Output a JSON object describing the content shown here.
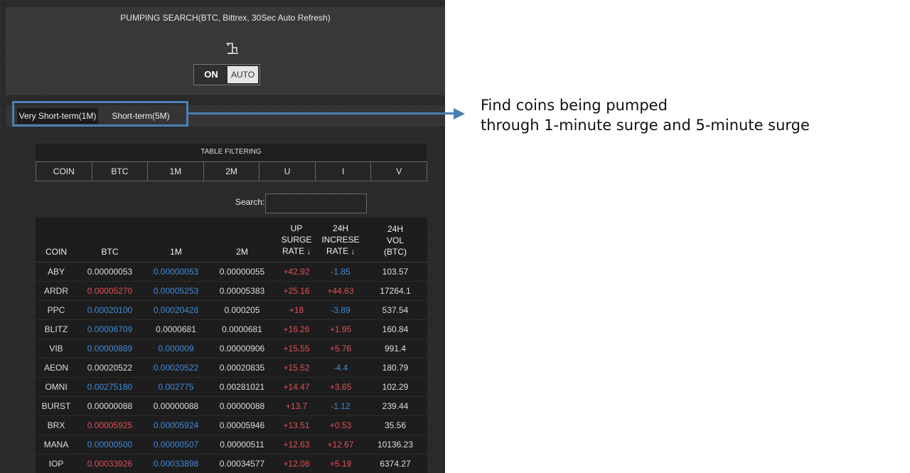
{
  "header": {
    "title": "PUMPING SEARCH(BTC, Bittrex, 30Sec Auto Refresh)",
    "refresh_icon": "refresh-icon",
    "toggle_on": "ON",
    "toggle_auto": "AUTO"
  },
  "tabs": [
    {
      "label": "Very Short-term(1M)"
    },
    {
      "label": "Short-term(5M)"
    }
  ],
  "filter": {
    "title": "TABLE FILTERING",
    "buttons": [
      "COIN",
      "BTC",
      "1M",
      "2M",
      "U",
      "I",
      "V"
    ]
  },
  "search": {
    "label": "Search:",
    "value": "",
    "placeholder": ""
  },
  "table": {
    "headers": {
      "coin": "COIN",
      "btc": "BTC",
      "m1": "1M",
      "m2": "2M",
      "up_l1": "UP",
      "up_l2": "SURGE",
      "up_l3": "RATE",
      "inc_l1": "24H",
      "inc_l2": "INCRESE",
      "inc_l3": "RATE",
      "vol_l1": "24H",
      "vol_l2": "VOL",
      "vol_l3": "(BTC)",
      "sort_arrow": "↓"
    },
    "rows": [
      {
        "coin": "ABY",
        "btc": "0.00000053",
        "m1": "0.00000053",
        "m2": "0.00000055",
        "up": "+42.92",
        "inc": "-1.85",
        "vol": "103.57"
      },
      {
        "coin": "ARDR",
        "btc": "0.00005270",
        "m1": "0.00005253",
        "m2": "0.00005383",
        "up": "+25.16",
        "inc": "+44.63",
        "vol": "17264.1"
      },
      {
        "coin": "PPC",
        "btc": "0.00020100",
        "m1": "0.00020428",
        "m2": "0.000205",
        "up": "+18",
        "inc": "-3.89",
        "vol": "537.54"
      },
      {
        "coin": "BLITZ",
        "btc": "0.00006709",
        "m1": "0.0000681",
        "m2": "0.0000681",
        "up": "+16.26",
        "inc": "+1.95",
        "vol": "160.84"
      },
      {
        "coin": "VIB",
        "btc": "0.00000889",
        "m1": "0.000009",
        "m2": "0.00000906",
        "up": "+15.55",
        "inc": "+5.76",
        "vol": "991.4"
      },
      {
        "coin": "AEON",
        "btc": "0.00020522",
        "m1": "0.00020522",
        "m2": "0.00020835",
        "up": "+15.52",
        "inc": "-4.4",
        "vol": "180.79"
      },
      {
        "coin": "OMNI",
        "btc": "0.00275180",
        "m1": "0.002775",
        "m2": "0.00281021",
        "up": "+14.47",
        "inc": "+3.65",
        "vol": "102.29"
      },
      {
        "coin": "BURST",
        "btc": "0.00000088",
        "m1": "0.00000088",
        "m2": "0.00000088",
        "up": "+13.7",
        "inc": "-1.12",
        "vol": "239.44"
      },
      {
        "coin": "BRX",
        "btc": "0.00005925",
        "m1": "0.00005924",
        "m2": "0.00005946",
        "up": "+13.51",
        "inc": "+0.53",
        "vol": "35.56"
      },
      {
        "coin": "MANA",
        "btc": "0.00000500",
        "m1": "0.00000507",
        "m2": "0.00000511",
        "up": "+12.63",
        "inc": "+12.67",
        "vol": "10136.23"
      },
      {
        "coin": "IOP",
        "btc": "0.00033926",
        "m1": "0.00033898",
        "m2": "0.00034577",
        "up": "+12.08",
        "inc": "+5.19",
        "vol": "6374.27"
      }
    ]
  },
  "cell_colors": {
    "rows": [
      {
        "btc": "white",
        "m1": "blue",
        "m2": "white",
        "up": "red",
        "inc": "blue"
      },
      {
        "btc": "red",
        "m1": "blue",
        "m2": "white",
        "up": "red",
        "inc": "red"
      },
      {
        "btc": "blue",
        "m1": "blue",
        "m2": "white",
        "up": "red",
        "inc": "blue"
      },
      {
        "btc": "blue",
        "m1": "white",
        "m2": "white",
        "up": "red",
        "inc": "red"
      },
      {
        "btc": "blue",
        "m1": "blue",
        "m2": "white",
        "up": "red",
        "inc": "red"
      },
      {
        "btc": "white",
        "m1": "blue",
        "m2": "white",
        "up": "red",
        "inc": "blue"
      },
      {
        "btc": "blue",
        "m1": "blue",
        "m2": "white",
        "up": "red",
        "inc": "red"
      },
      {
        "btc": "white",
        "m1": "white",
        "m2": "white",
        "up": "red",
        "inc": "blue"
      },
      {
        "btc": "red",
        "m1": "blue",
        "m2": "white",
        "up": "red",
        "inc": "red"
      },
      {
        "btc": "blue",
        "m1": "blue",
        "m2": "white",
        "up": "red",
        "inc": "red"
      },
      {
        "btc": "red",
        "m1": "blue",
        "m2": "white",
        "up": "red",
        "inc": "red"
      }
    ]
  },
  "annotation": {
    "line1": "Find coins being pumped",
    "line2": "through 1-minute surge and 5-minute surge"
  },
  "colors": {
    "accent": "#4a7fb5",
    "up_red": "#e0505a",
    "down_blue": "#3f8ad8",
    "panel_bg": "#2a2a2a"
  }
}
